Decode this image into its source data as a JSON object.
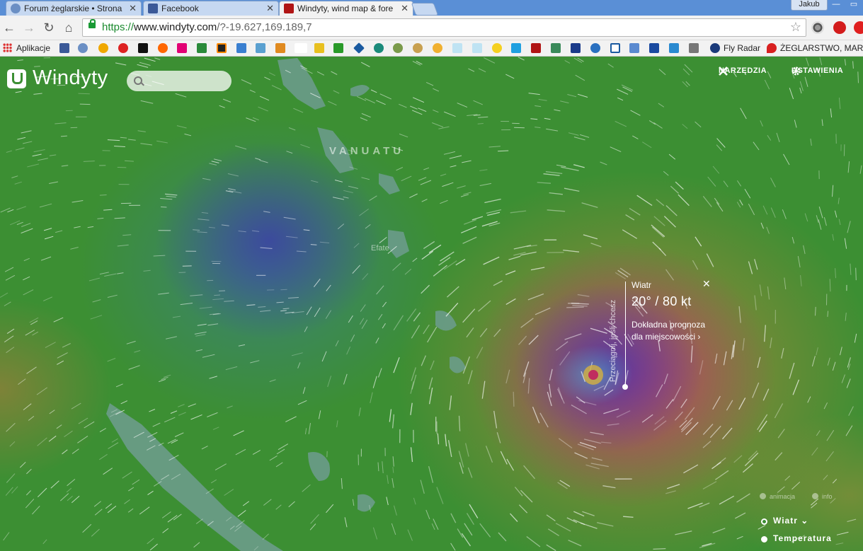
{
  "tabs": [
    {
      "title": "Forum żeglarskie • Strona",
      "active": false
    },
    {
      "title": "Facebook",
      "active": false
    },
    {
      "title": "Windyty, wind map & fore",
      "active": true
    }
  ],
  "window_user": "Jakub",
  "address": {
    "scheme": "https://",
    "host": "www.windyty.com",
    "path": "/?-19.627,169.189,7"
  },
  "bookmarks": {
    "apps_label": "Aplikacje",
    "fly_radar": "Fly Radar",
    "zeglarstwo": "ŻEGLARSTWO, MAR..."
  },
  "app": {
    "logo": "Windyty",
    "search_placeholder": "",
    "tools": "NARZĘDZIA",
    "settings": "USTAWIENIA"
  },
  "map_labels": {
    "vanuatu": "VANUATU",
    "place": "Efate"
  },
  "popup": {
    "label": "Wiatr",
    "value": "20° / 80 kt",
    "link_line1": "Dokładna prognoza",
    "link_line2": "dla miejscowości",
    "hint": "Przeciągnij, jeśli chcesz"
  },
  "controls": {
    "animation": "animacja",
    "info": "info",
    "layer_wind": "Wiatr",
    "layer_temp": "Temperatura"
  },
  "colors": {
    "map_green": "#3c8f33",
    "storm_magenta": "#b4287a",
    "storm_blue": "#463caa",
    "brand_red": "#b01515"
  }
}
